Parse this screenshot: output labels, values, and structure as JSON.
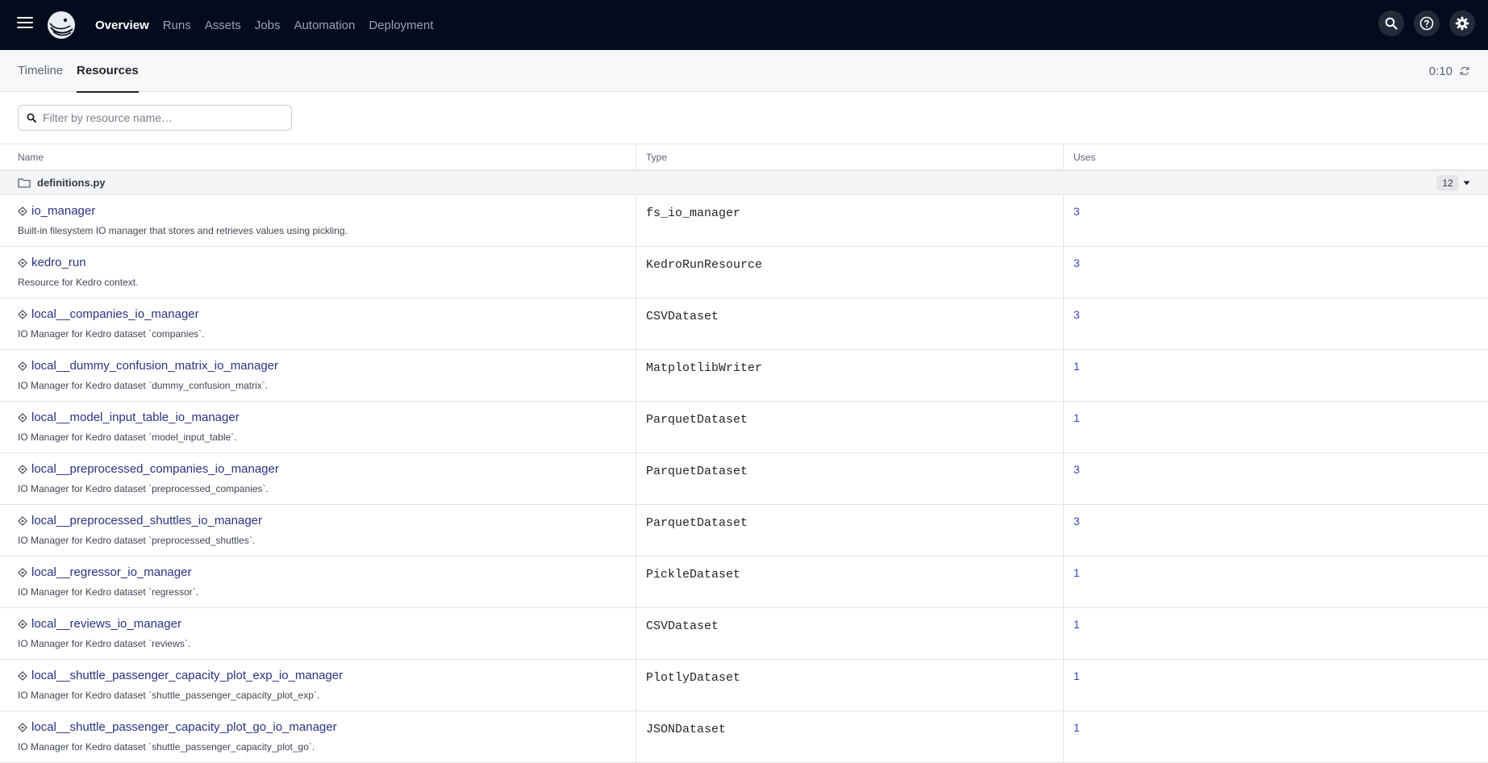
{
  "nav": {
    "items": [
      {
        "label": "Overview",
        "active": true
      },
      {
        "label": "Runs",
        "active": false
      },
      {
        "label": "Assets",
        "active": false
      },
      {
        "label": "Jobs",
        "active": false
      },
      {
        "label": "Automation",
        "active": false
      },
      {
        "label": "Deployment",
        "active": false
      }
    ],
    "icons": [
      "search-icon",
      "help-icon",
      "gear-icon"
    ]
  },
  "subtabs": {
    "timeline": "Timeline",
    "resources": "Resources",
    "active": "resources"
  },
  "refresh": {
    "timer": "0:10"
  },
  "filter": {
    "placeholder": "Filter by resource name…",
    "value": ""
  },
  "table": {
    "headers": {
      "name": "Name",
      "type": "Type",
      "uses": "Uses"
    },
    "group": {
      "name": "definitions.py",
      "count": "12"
    },
    "rows": [
      {
        "name": "io_manager",
        "description": "Built-in filesystem IO manager that stores and retrieves values using pickling.",
        "type": "fs_io_manager",
        "uses": "3"
      },
      {
        "name": "kedro_run",
        "description": "Resource for Kedro context.",
        "type": "KedroRunResource",
        "uses": "3"
      },
      {
        "name": "local__companies_io_manager",
        "description": "IO Manager for Kedro dataset `companies`.",
        "type": "CSVDataset",
        "uses": "3"
      },
      {
        "name": "local__dummy_confusion_matrix_io_manager",
        "description": "IO Manager for Kedro dataset `dummy_confusion_matrix`.",
        "type": "MatplotlibWriter",
        "uses": "1"
      },
      {
        "name": "local__model_input_table_io_manager",
        "description": "IO Manager for Kedro dataset `model_input_table`.",
        "type": "ParquetDataset",
        "uses": "1"
      },
      {
        "name": "local__preprocessed_companies_io_manager",
        "description": "IO Manager for Kedro dataset `preprocessed_companies`.",
        "type": "ParquetDataset",
        "uses": "3"
      },
      {
        "name": "local__preprocessed_shuttles_io_manager",
        "description": "IO Manager for Kedro dataset `preprocessed_shuttles`.",
        "type": "ParquetDataset",
        "uses": "3"
      },
      {
        "name": "local__regressor_io_manager",
        "description": "IO Manager for Kedro dataset `regressor`.",
        "type": "PickleDataset",
        "uses": "1"
      },
      {
        "name": "local__reviews_io_manager",
        "description": "IO Manager for Kedro dataset `reviews`.",
        "type": "CSVDataset",
        "uses": "1"
      },
      {
        "name": "local__shuttle_passenger_capacity_plot_exp_io_manager",
        "description": "IO Manager for Kedro dataset `shuttle_passenger_capacity_plot_exp`.",
        "type": "PlotlyDataset",
        "uses": "1"
      },
      {
        "name": "local__shuttle_passenger_capacity_plot_go_io_manager",
        "description": "IO Manager for Kedro dataset `shuttle_passenger_capacity_plot_go`.",
        "type": "JSONDataset",
        "uses": "1"
      }
    ]
  }
}
